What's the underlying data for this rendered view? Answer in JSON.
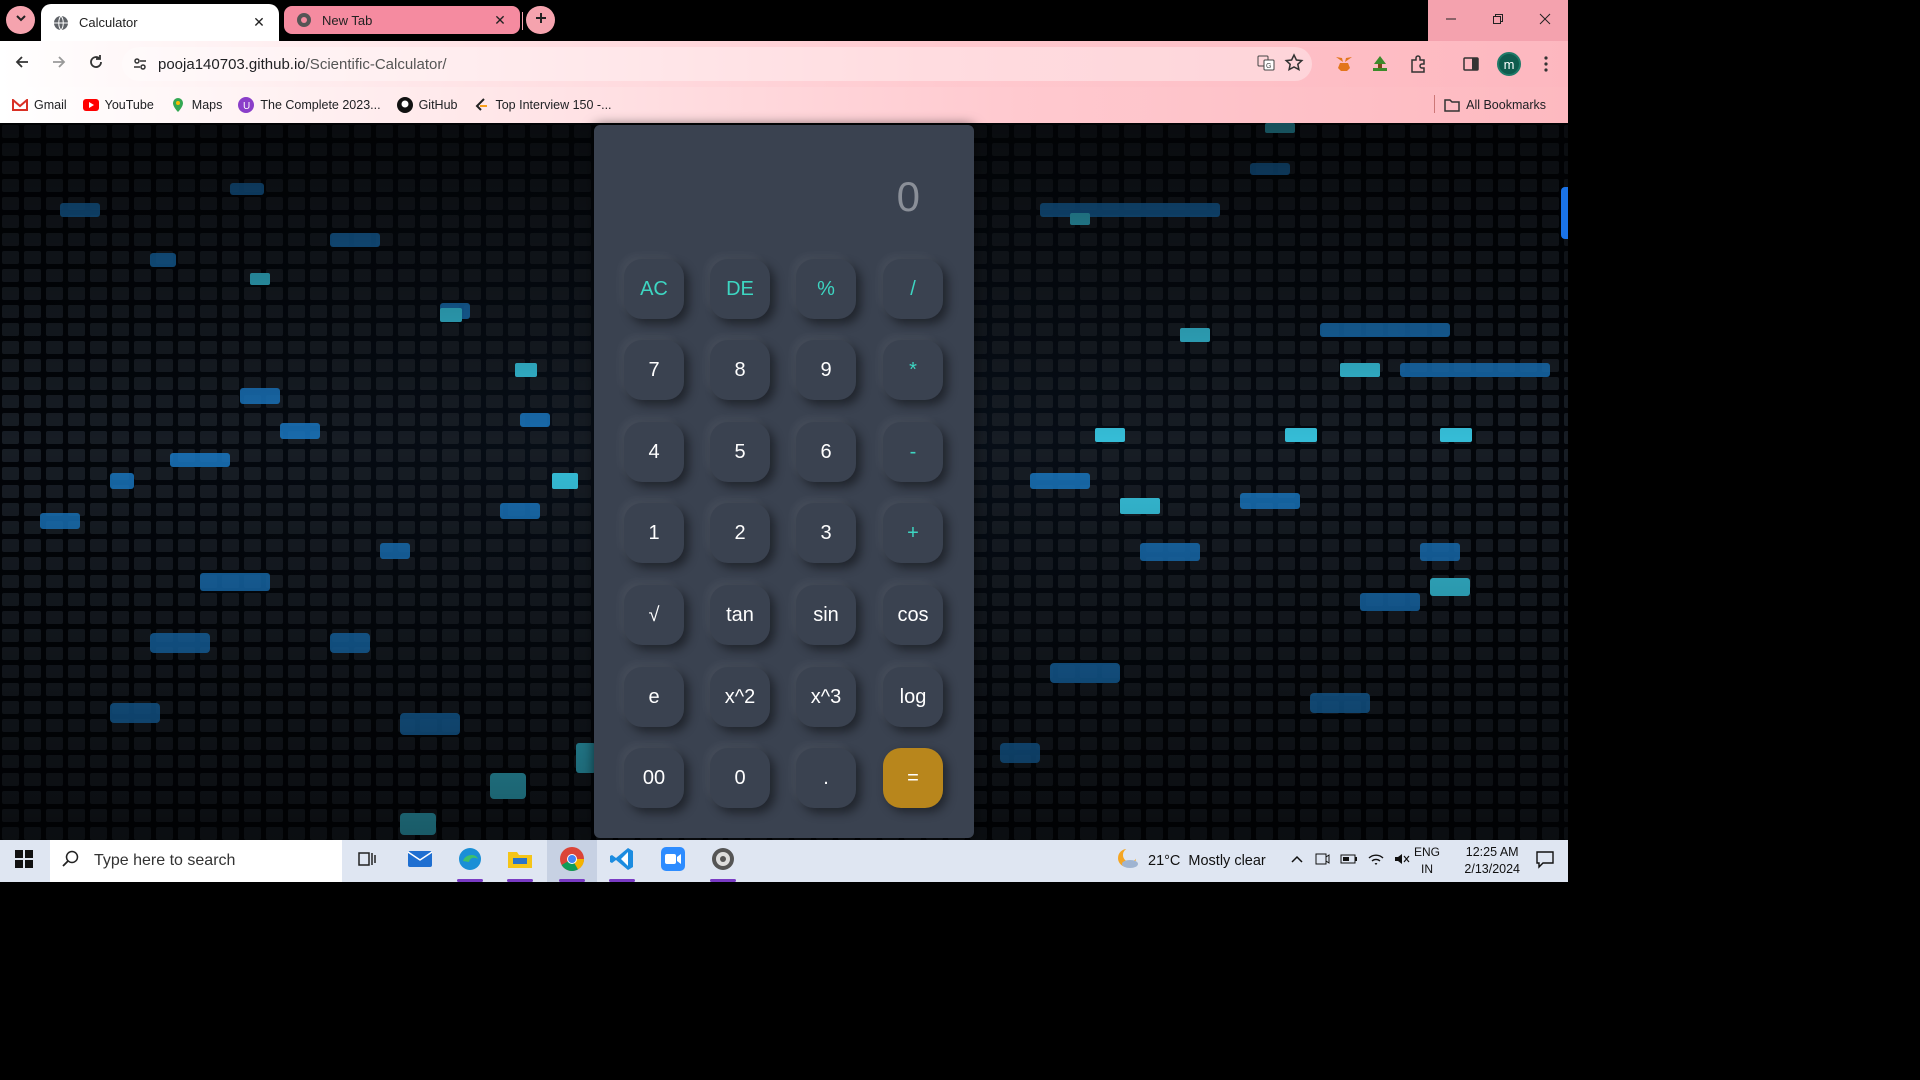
{
  "browser": {
    "tabs": [
      {
        "title": "Calculator",
        "active": true
      },
      {
        "title": "New Tab",
        "active": false
      }
    ],
    "url": {
      "host": "pooja140703.github.io",
      "path": "/Scientific-Calculator/"
    },
    "profile_initial": "m",
    "bookmarks": [
      {
        "label": "Gmail",
        "icon": "gmail-icon"
      },
      {
        "label": "YouTube",
        "icon": "youtube-icon"
      },
      {
        "label": "Maps",
        "icon": "maps-icon"
      },
      {
        "label": "The Complete 2023...",
        "icon": "udemy-icon"
      },
      {
        "label": "GitHub",
        "icon": "github-icon"
      },
      {
        "label": "Top Interview 150 -...",
        "icon": "leetcode-icon"
      }
    ],
    "all_bookmarks_label": "All Bookmarks"
  },
  "calculator": {
    "display": "0",
    "keys": [
      {
        "label": "AC",
        "style": "teal"
      },
      {
        "label": "DE",
        "style": "teal"
      },
      {
        "label": "%",
        "style": "teal"
      },
      {
        "label": "/",
        "style": "teal"
      },
      {
        "label": "7",
        "style": "plain"
      },
      {
        "label": "8",
        "style": "plain"
      },
      {
        "label": "9",
        "style": "plain"
      },
      {
        "label": "*",
        "style": "teal"
      },
      {
        "label": "4",
        "style": "plain"
      },
      {
        "label": "5",
        "style": "plain"
      },
      {
        "label": "6",
        "style": "plain"
      },
      {
        "label": "-",
        "style": "teal"
      },
      {
        "label": "1",
        "style": "plain"
      },
      {
        "label": "2",
        "style": "plain"
      },
      {
        "label": "3",
        "style": "plain"
      },
      {
        "label": "+",
        "style": "teal"
      },
      {
        "label": "√",
        "style": "plain"
      },
      {
        "label": "tan",
        "style": "plain"
      },
      {
        "label": "sin",
        "style": "plain"
      },
      {
        "label": "cos",
        "style": "plain"
      },
      {
        "label": "e",
        "style": "plain"
      },
      {
        "label": "x^2",
        "style": "plain"
      },
      {
        "label": "x^3",
        "style": "plain"
      },
      {
        "label": "log",
        "style": "plain"
      },
      {
        "label": "00",
        "style": "plain"
      },
      {
        "label": "0",
        "style": "plain"
      },
      {
        "label": ".",
        "style": "plain"
      },
      {
        "label": "=",
        "style": "equals"
      }
    ]
  },
  "taskbar": {
    "search_placeholder": "Type here to search",
    "weather": {
      "temp": "21°C",
      "condition": "Mostly clear"
    },
    "language": {
      "line1": "ENG",
      "line2": "IN"
    },
    "clock": {
      "time": "12:25 AM",
      "date": "2/13/2024"
    }
  },
  "colors": {
    "accent_teal": "#3dd6c2",
    "equals_gold": "#b8861c",
    "calc_body": "#3a4250",
    "tab_pink": "#f58ba0"
  }
}
